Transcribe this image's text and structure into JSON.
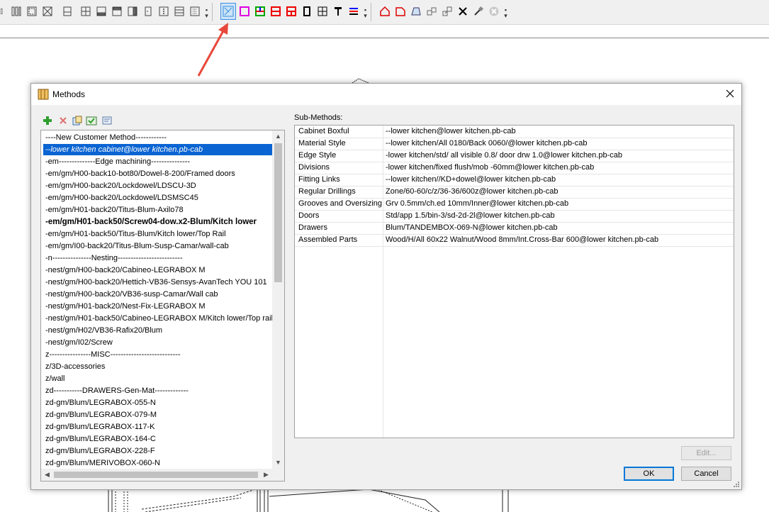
{
  "toolbar": {
    "icons": [
      "vertical-bars-icon",
      "frame-icon",
      "cube-icon",
      "panel-icon",
      "split-icon",
      "bottom-shelf-icon",
      "top-shelf-icon",
      "side-panel-icon",
      "door-icon",
      "dots-icon",
      "drawer-icon",
      "rails-icon",
      "methods-tool-icon",
      "magenta-square-icon",
      "rgb-square-icon",
      "red-split-icon",
      "black-frame-icon",
      "hardware-icon",
      "screw-icon",
      "color-lines-icon",
      "house-icon",
      "shape-icon",
      "trapezoid-icon",
      "stack-icon",
      "copy-shape-icon",
      "pin-icon",
      "brush-icon",
      "close-circle-icon"
    ],
    "active_icon": "methods-tool-icon"
  },
  "dialog": {
    "title": "Methods",
    "sub_methods_label": "Sub-Methods:",
    "buttons": {
      "edit": "Edit...",
      "ok": "OK",
      "cancel": "Cancel"
    }
  },
  "methods": [
    "----New Customer Method------------",
    "--lower kitchen cabinet@lower kitchen.pb-cab",
    "-em--------------Edge machining---------------",
    "-em/gm/H00-back10-bot80/Dowel-8-200/Framed doors",
    "-em/gm/H00-back20/Lockdowel/LDSCU-3D",
    "-em/gm/H00-back20/Lockdowel/LDSMSC45",
    "-em/gm/H01-back20/Titus-Blum-Axilo78",
    "-em/gm/H01-back50/Screw04-dow.x2-Blum/Kitch lower",
    "-em/gm/H01-back50/Titus-Blum/Kitch lower/Top Rail",
    "-em/gm/I00-back20/Titus-Blum-Susp-Camar/wall-cab",
    "-n---------------Nesting-------------------------",
    "-nest/gm/H00-back20/Cabineo-LEGRABOX M",
    "-nest/gm/H00-back20/Hettich-VB36-Sensys-AvanTech YOU 101",
    "-nest/gm/H00-back20/VB36-susp-Camar/Wall cab",
    "-nest/gm/H01-back20/Nest-Fix-LEGRABOX M",
    "-nest/gm/H01-back50/Cabineo-LEGRABOX M/Kitch lower/Top rail",
    "-nest/gm/H02/VB36-Rafix20/Blum",
    "-nest/gm/I02/Screw",
    "z----------------MISC---------------------------",
    "z/3D-accessories",
    "z/wall",
    "zd-----------DRAWERS-Gen-Mat-------------",
    "zd-gm/Blum/LEGRABOX-055-N",
    "zd-gm/Blum/LEGRABOX-079-M",
    "zd-gm/Blum/LEGRABOX-117-K",
    "zd-gm/Blum/LEGRABOX-164-C",
    "zd-gm/Blum/LEGRABOX-228-F",
    "zd-gm/Blum/MERIVOBOX-060-N"
  ],
  "selected_method_index": 1,
  "bold_method_index": 7,
  "sub_methods": [
    {
      "name": "Cabinet Boxful",
      "value": "--lower kitchen@lower kitchen.pb-cab"
    },
    {
      "name": "Material Style",
      "value": "--lower kitchen/All 0180/Back 0060/@lower kitchen.pb-cab"
    },
    {
      "name": "Edge Style",
      "value": "-lower kitchen/std/ all visible 0.8/ door drw 1.0@lower kitchen.pb-cab"
    },
    {
      "name": "Divisions",
      "value": "-lower kitchen/fixed flush/mob -60mm@lower kitchen.pb-cab"
    },
    {
      "name": "Fitting Links",
      "value": "--lower kitchen//KD+dowel@lower kitchen.pb-cab"
    },
    {
      "name": "Regular Drillings",
      "value": "Zone/60-60/c/z/36-36/600z@lower kitchen.pb-cab"
    },
    {
      "name": "Grooves and Oversizing",
      "value": "Grv 0.5mm/ch.ed 10mm/Inner@lower kitchen.pb-cab"
    },
    {
      "name": "Doors",
      "value": "Std/app 1.5/bin-3/sd-2d-2l@lower kitchen.pb-cab"
    },
    {
      "name": "Drawers",
      "value": "Blum/TANDEMBOX-069-N@lower kitchen.pb-cab"
    },
    {
      "name": "Assembled Parts",
      "value": "Wood/H/All 60x22 Walnut/Wood 8mm/Int.Cross-Bar 600@lower kitchen.pb-cab"
    }
  ]
}
